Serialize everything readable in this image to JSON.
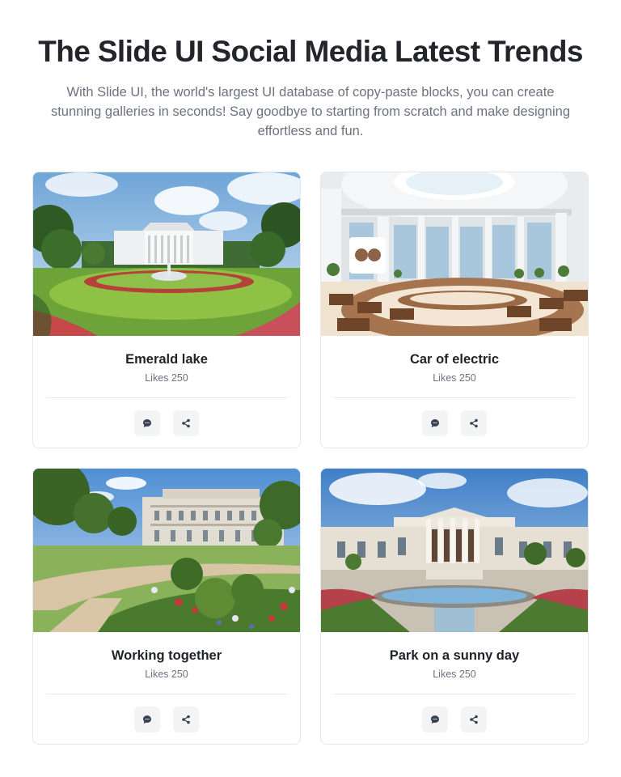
{
  "header": {
    "title": "The Slide UI Social Media Latest Trends",
    "subtitle": "With Slide UI, the world's largest UI database of copy-paste blocks, you can create stunning galleries in seconds! Say goodbye to starting from scratch and make designing effortless and fun."
  },
  "cards": [
    {
      "title": "Emerald lake",
      "likes": "Likes 250",
      "image": "white-house-garden"
    },
    {
      "title": "Car of electric",
      "likes": "Likes 250",
      "image": "round-hall-interior"
    },
    {
      "title": "Working together",
      "likes": "Likes 250",
      "image": "palace-garden"
    },
    {
      "title": "Park on a sunny day",
      "likes": "Likes 250",
      "image": "columned-building-fountain"
    }
  ],
  "icons": {
    "comment": "chat-bubble-icon",
    "share": "share-icon"
  },
  "colors": {
    "icon": "#374151",
    "button_bg": "#f3f4f6",
    "border": "#e5e7eb",
    "muted_text": "#6b7280"
  }
}
